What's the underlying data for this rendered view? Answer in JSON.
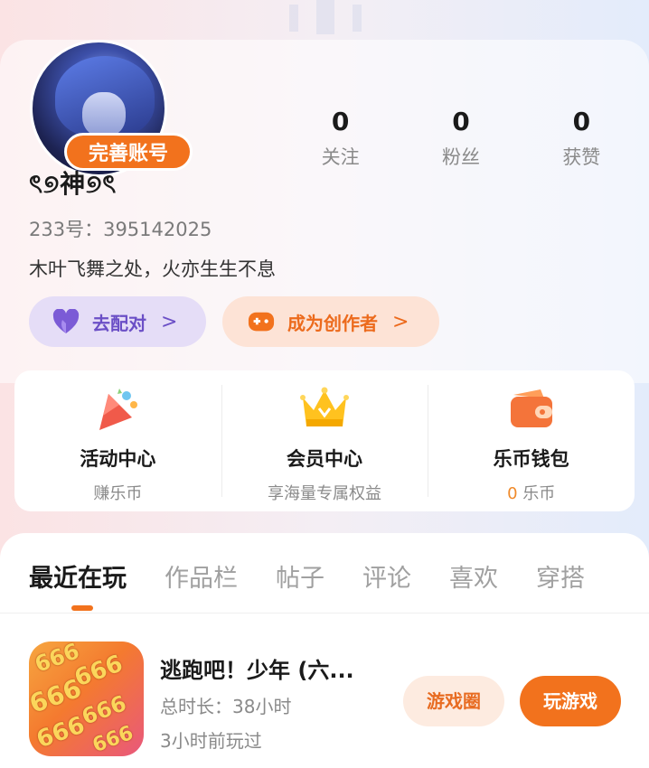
{
  "profile": {
    "complete_label": "完善账号",
    "nickname": "ৎ୭神୭ৎ",
    "uid": "233号：395142025",
    "bio": "木叶飞舞之处，火亦生生不息"
  },
  "stats": [
    {
      "value": "0",
      "label": "关注"
    },
    {
      "value": "0",
      "label": "粉丝"
    },
    {
      "value": "0",
      "label": "获赞"
    }
  ],
  "actions": {
    "match_label": "去配对",
    "creator_label": "成为创作者",
    "arrow": ">"
  },
  "services": [
    {
      "title": "活动中心",
      "sub": "赚乐币",
      "icon": "party-popper-icon"
    },
    {
      "title": "会员中心",
      "sub": "享海量专属权益",
      "icon": "crown-icon"
    },
    {
      "title": "乐币钱包",
      "sub_value": "0",
      "sub_unit": " 乐币",
      "icon": "wallet-icon"
    }
  ],
  "tabs": [
    "最近在玩",
    "作品栏",
    "帖子",
    "评论",
    "喜欢",
    "穿搭"
  ],
  "active_tab": "最近在玩",
  "recent_game": {
    "title": "逃跑吧！少年 (六...",
    "play_time": "总时长：38小时",
    "last_played": "3小时前玩过",
    "circle_button": "游戏圈",
    "play_button": "玩游戏",
    "icon_text": "666"
  },
  "colors": {
    "accent": "#f2721d",
    "match_bg": "#e5ddf7",
    "match_fg": "#6b4fc6",
    "creator_bg": "#fde3d6"
  }
}
